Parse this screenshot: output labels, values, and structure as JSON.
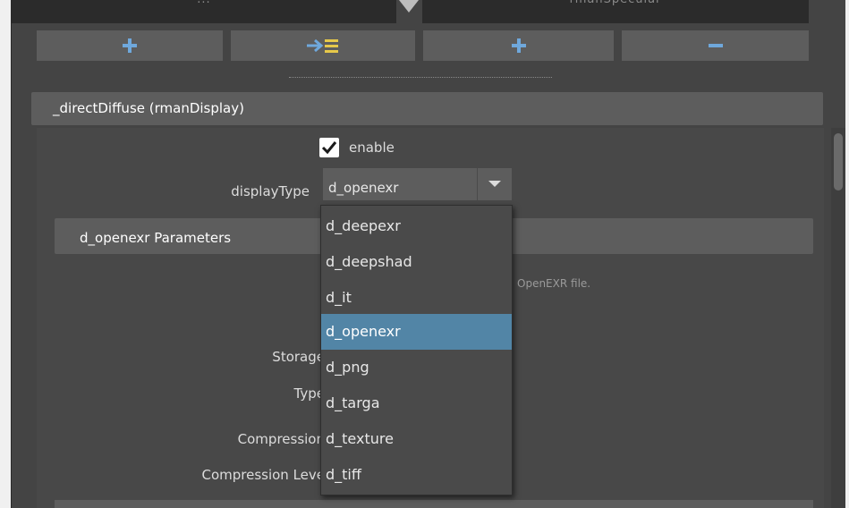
{
  "toolbar": {
    "top_left_field": "...",
    "top_right_field": "rmanSpecular",
    "buttons": [
      {
        "icon": "plus-icon"
      },
      {
        "icon": "arrow-right-list-icon"
      },
      {
        "icon": "plus-icon"
      },
      {
        "icon": "minus-icon"
      }
    ]
  },
  "section": {
    "title": "_directDiffuse  (rmanDisplay)",
    "enable": {
      "label": "enable",
      "checked": true
    },
    "display_type": {
      "label": "displayType",
      "value": "d_openexr"
    }
  },
  "subsection": {
    "title": "d_openexr Parameters",
    "description": "OpenEXR file.",
    "field_labels": [
      "Storage",
      "Type",
      "Compression",
      "Compression Leve"
    ]
  },
  "dropdown": {
    "options": [
      "d_deepexr",
      "d_deepshad",
      "d_it",
      "d_openexr",
      "d_png",
      "d_targa",
      "d_texture",
      "d_tiff"
    ],
    "selected": "d_openexr"
  },
  "colors": {
    "panel_bg": "#444444",
    "header_bg": "#5d5d5d",
    "accent_blue": "#6fa8dc",
    "selection_blue": "#5285a6",
    "list_yellow": "#e6c84a"
  }
}
